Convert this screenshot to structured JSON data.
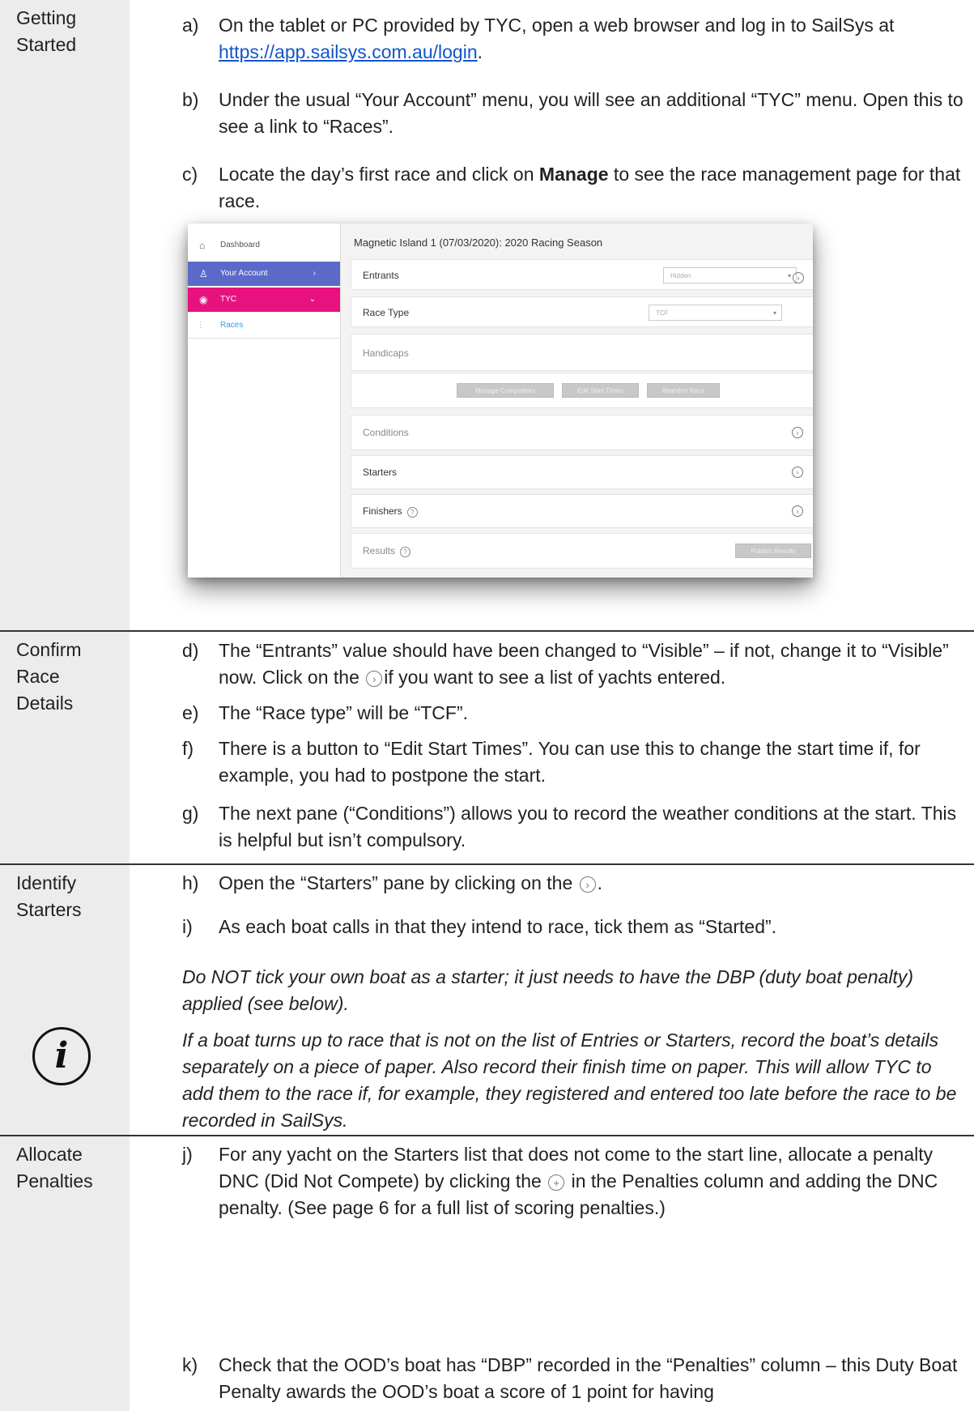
{
  "sections": {
    "getting_started": {
      "label": "Getting Started",
      "a": {
        "letter": "a)",
        "pre": "On the tablet or PC provided by TYC, open a web browser and log in to SailSys at ",
        "link": "https://app.sailsys.com.au/login",
        "post": "."
      },
      "b": {
        "letter": "b)",
        "text": "Under the usual “Your Account” menu, you will see an additional “TYC” menu.  Open this to see a link to “Races”."
      },
      "c": {
        "letter": "c)",
        "pre": "Locate the day’s first race and click on ",
        "bold": "Manage",
        "post": " to see the race management page for that race."
      }
    },
    "confirm": {
      "label": "Confirm Race Details",
      "d": {
        "letter": "d)",
        "pre": "The “Entrants” value should have been changed to “Visible” – if not, change it to “Visible” now.  Click on the ",
        "post": "if you want to see a list of yachts entered."
      },
      "e": {
        "letter": "e)",
        "text": "The “Race type” will be “TCF”."
      },
      "f": {
        "letter": "f)",
        "text": "There is a button to “Edit Start Times”.  You can use this to change the start time if, for example, you had to postpone the start."
      },
      "g": {
        "letter": "g)",
        "text": "The next pane (“Conditions”) allows you to record the weather conditions at the start.  This is helpful but isn’t compulsory."
      }
    },
    "identify": {
      "label": "Identify Starters",
      "h": {
        "letter": "h)",
        "pre": "Open the “Starters” pane by clicking on the ",
        "post": "."
      },
      "i": {
        "letter": "i)",
        "text": "As each boat calls in that they intend to race, tick them as “Started”."
      },
      "note1": "Do NOT tick your own boat as a starter; it just needs to have the DBP (duty boat penalty) applied (see below).",
      "note2": "If a boat turns up to race that is not on the list of Entries or Starters, record the boat’s details separately on a piece of paper.  Also record their finish time on paper.  This will allow TYC to add them to the race if, for example, they registered and entered too late before the race to be recorded in SailSys."
    },
    "allocate": {
      "label": "Allocate Penalties",
      "j": {
        "letter": "j)",
        "pre": "For any yacht on the Starters list that does not come to the start line, allocate a penalty DNC (Did Not Compete) by clicking the ",
        "post": " in the Penalties column and adding the DNC penalty. (See page 6 for a full list of scoring penalties.)"
      },
      "k": {
        "letter": "k)",
        "text": "Check that the OOD’s boat has “DBP” recorded in the “Penalties” column – this Duty Boat Penalty awards the OOD’s boat a score of 1 point for having"
      }
    }
  },
  "screenshot": {
    "sidebar": {
      "dashboard": "Dashboard",
      "your_account": "Your Account",
      "tyc": "TYC",
      "races": "Races"
    },
    "title": "Magnetic Island 1 (07/03/2020): 2020 Racing Season",
    "rows": {
      "entrants": "Entrants",
      "entrants_value": "Hidden",
      "race_type": "Race Type",
      "race_type_value": "TCF",
      "handicaps": "Handicaps",
      "btn_manage": "Manage Competitors",
      "btn_edit": "Edit Start Times",
      "btn_abandon": "Abandon Race",
      "conditions": "Conditions",
      "starters": "Starters",
      "finishers": "Finishers",
      "results": "Results",
      "btn_results": "Publish Results"
    },
    "colors": {
      "your_account_bg": "#5b6ac9",
      "tyc_bg": "#e8127f",
      "races_text": "#3a9ad9"
    }
  }
}
